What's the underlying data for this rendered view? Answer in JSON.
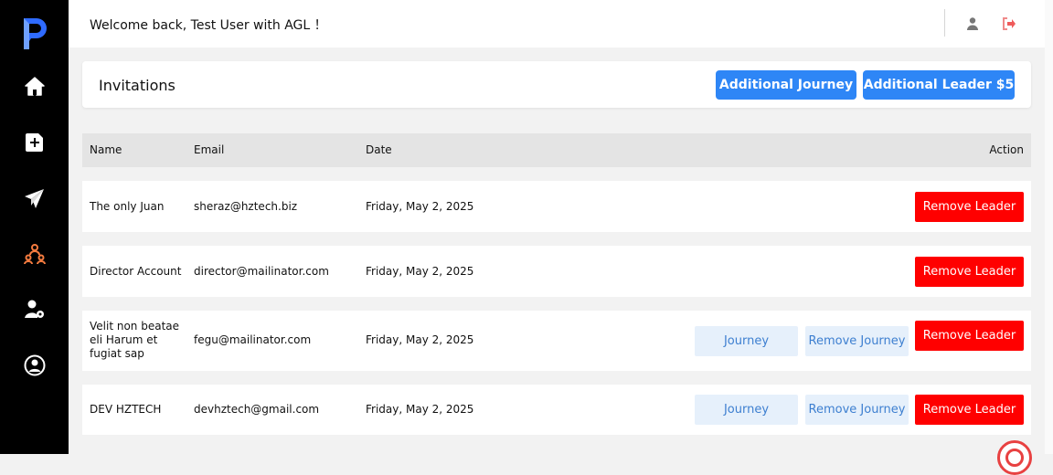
{
  "header": {
    "welcome_text": "Welcome back, Test User with AGL ！"
  },
  "sidebar": {
    "items": [
      {
        "icon": "home-icon",
        "color": "#ffffff"
      },
      {
        "icon": "add-document-icon",
        "color": "#ffffff"
      },
      {
        "icon": "send-icon",
        "color": "#ffffff"
      },
      {
        "icon": "team-icon",
        "color": "#f47b3f",
        "active": true
      },
      {
        "icon": "user-settings-icon",
        "color": "#ffffff"
      },
      {
        "icon": "profile-icon",
        "color": "#ffffff"
      }
    ]
  },
  "invitations": {
    "title": "Invitations",
    "additional_journey_label": "Additional Journey",
    "additional_leader_label": "Additional Leader $5"
  },
  "table": {
    "columns": {
      "name": "Name",
      "email": "Email",
      "date": "Date",
      "action": "Action"
    },
    "rows": [
      {
        "name": "The only  Juan",
        "email": "sheraz@hztech.biz",
        "date": "Friday, May 2, 2025"
      },
      {
        "name": "Director Account",
        "email": "director@mailinator.com",
        "date": "Friday, May 2, 2025"
      },
      {
        "name": "Velit non beatae eli Harum et fugiat sap",
        "email": "fegu@mailinator.com",
        "date": "Friday, May 2, 2025"
      },
      {
        "name": "DEV HZTECH",
        "email": "devhztech@gmail.com",
        "date": "Friday, May 2, 2025"
      }
    ],
    "remove_leader_label": "Remove Leader",
    "journey_label": "Journey",
    "remove_journey_label": "Remove Journey"
  },
  "colors": {
    "accent_blue": "#2e86f6",
    "danger_red": "#ff0000",
    "active_nav": "#f47b3f",
    "logo_blue": "#2f6bff"
  }
}
